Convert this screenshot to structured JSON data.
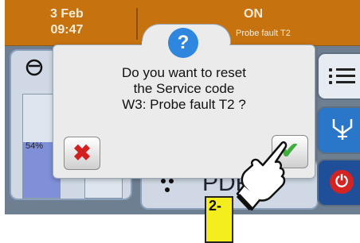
{
  "topbar": {
    "date": "3 Feb",
    "time": "09:47",
    "status": "ON",
    "substatus": "Probe fault T2"
  },
  "level": {
    "percent_label": "54%",
    "fraction": 0.54
  },
  "bottom_text": "PDF",
  "dialog": {
    "help_icon_glyph": "?",
    "line1": "Do you want to reset",
    "line2": "the Service code",
    "line3": "W3: Probe fault T2 ?",
    "cancel_glyph": "✖",
    "confirm_glyph": "✔"
  },
  "step_label": "2-",
  "colors": {
    "topbar": "#c6720f",
    "help": "#2e86de",
    "cancel": "#d21f1f",
    "confirm": "#3fae3f",
    "step_label": "#f5ee1e"
  },
  "icons": [
    "pump-icon",
    "menu-list-icon",
    "valve-icon",
    "power-icon",
    "help-icon",
    "cancel-icon",
    "confirm-check-icon",
    "pointing-hand-icon"
  ]
}
